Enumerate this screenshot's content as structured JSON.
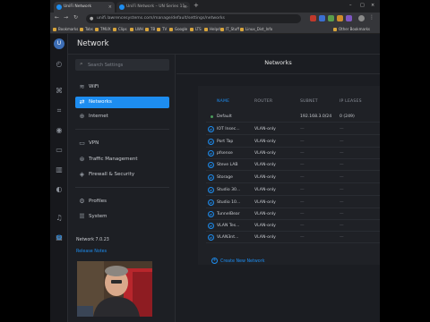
{
  "browser": {
    "tabs": [
      {
        "title": "UniFi Network"
      },
      {
        "title": "UniFi Network – UN Series 11..."
      }
    ],
    "url": "unifi.lawrencesystems.com/manage/default/settings/networks",
    "bookmarks": [
      "Bookmarks",
      "Tabs",
      "TMUX",
      "Clips",
      "LWH",
      "TB",
      "TV",
      "Google",
      "LTS",
      "Helpd",
      "IT_Stuff",
      "Linux_Dist_Info",
      "Other Bookmarks"
    ]
  },
  "app": {
    "title": "Network",
    "logo_text": "U"
  },
  "sidebar": {
    "search_placeholder": "Search Settings",
    "items": [
      {
        "label": "WiFi",
        "icon": "wifi-icon"
      },
      {
        "label": "Networks",
        "icon": "networks-icon"
      },
      {
        "label": "Internet",
        "icon": "globe-icon"
      },
      {
        "label": "VPN",
        "icon": "vpn-icon"
      },
      {
        "label": "Traffic Management",
        "icon": "traffic-icon"
      },
      {
        "label": "Firewall & Security",
        "icon": "shield-icon"
      },
      {
        "label": "Profiles",
        "icon": "profiles-icon"
      },
      {
        "label": "System",
        "icon": "system-icon"
      }
    ],
    "version": "Network 7.0.23",
    "release_notes": "Release Notes"
  },
  "networks": {
    "title": "Networks",
    "columns": [
      "NAME",
      "ROUTER",
      "SUBNET",
      "IP LEASES"
    ],
    "rows": [
      {
        "name": "Default",
        "router": "",
        "subnet": "192.168.3.0/24",
        "leases": "0 (249)",
        "default": true
      },
      {
        "name": "IOT Insec...",
        "router": "VLAN-only",
        "subnet": "—",
        "leases": "—"
      },
      {
        "name": "Port Tap",
        "router": "VLAN-only",
        "subnet": "—",
        "leases": "—"
      },
      {
        "name": "pfsense",
        "router": "VLAN-only",
        "subnet": "—",
        "leases": "—"
      },
      {
        "name": "Steve LAB",
        "router": "VLAN-only",
        "subnet": "—",
        "leases": "—"
      },
      {
        "name": "Storage",
        "router": "VLAN-only",
        "subnet": "—",
        "leases": "—"
      },
      {
        "name": "Studio 30...",
        "router": "VLAN-only",
        "subnet": "—",
        "leases": "—"
      },
      {
        "name": "Studio 10...",
        "router": "VLAN-only",
        "subnet": "—",
        "leases": "—"
      },
      {
        "name": "TunnelBear",
        "router": "VLAN-only",
        "subnet": "—",
        "leases": "—"
      },
      {
        "name": "VLAN Tes...",
        "router": "VLAN-only",
        "subnet": "—",
        "leases": "—"
      },
      {
        "name": "VLAN3nt...",
        "router": "VLAN-only",
        "subnet": "—",
        "leases": "—"
      }
    ],
    "create_label": "Create New Network"
  },
  "colors": {
    "accent": "#1d8df0",
    "background": "#1b1d22"
  }
}
